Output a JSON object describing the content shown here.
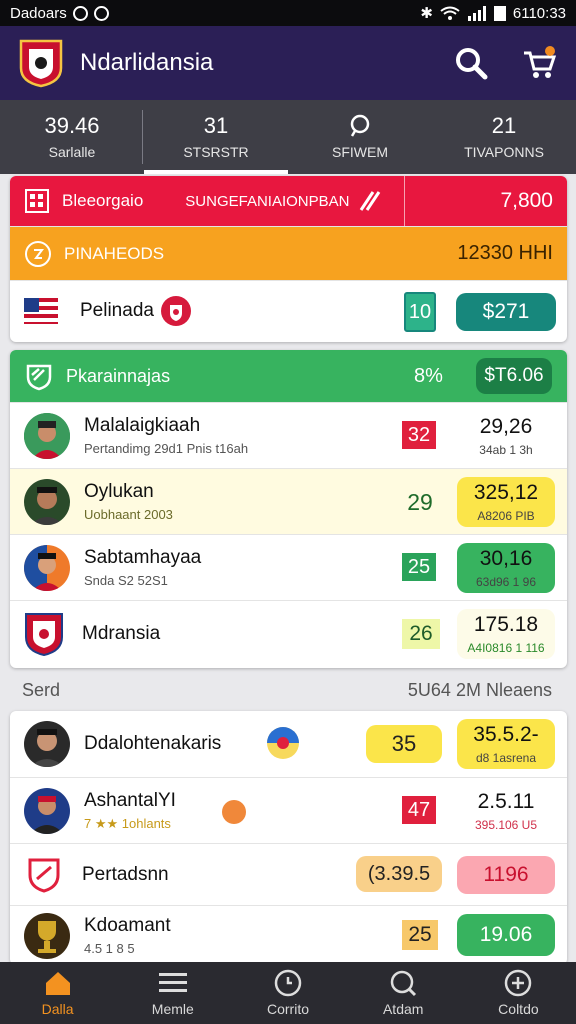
{
  "status_bar": {
    "carrier": "Dadoars",
    "time": "6110:33"
  },
  "app": {
    "title": "Ndarlidansia"
  },
  "tabs": [
    {
      "value": "39.46",
      "label": "Sarlalle"
    },
    {
      "value": "31",
      "label": "STSRSTR"
    },
    {
      "value": "",
      "label": "SFIWEM"
    },
    {
      "value": "21",
      "label": "TIVAPONNS"
    }
  ],
  "card1": {
    "header": {
      "left": "Bleeorgaio",
      "center": "SUNGEFANIAIONPBAN",
      "value": "7,800"
    },
    "sub_header": {
      "label": "PINAHEODS",
      "value": "12330 HHI"
    },
    "row": {
      "name": "Pelinada",
      "badge": "10",
      "value": "$271"
    }
  },
  "card2": {
    "header": {
      "label": "Pkarainnajas",
      "percent": "8%",
      "value": "$T6.06"
    },
    "rows": [
      {
        "name": "Malalaigkiaah",
        "sub": "Pertandimg 29d1 Pnis t16ah",
        "score": "32",
        "main": "29,26",
        "detail": "34ab 1 3h"
      },
      {
        "name": "Oylukan",
        "sub": "Uobhaant 2003",
        "score": "29",
        "main": "325,12",
        "detail": "A8206 PIB"
      },
      {
        "name": "Sabtamhayaa",
        "sub": "Snda S2 52S1",
        "score": "25",
        "main": "30,16",
        "detail": "63d96 1 96"
      },
      {
        "name": "Mdransia",
        "sub": "",
        "score": "26",
        "main": "175.18",
        "detail": "A4I0816 1 116"
      }
    ]
  },
  "section": {
    "title": "Serd",
    "meta": "5U64 2M Nleaens"
  },
  "card3": {
    "rows": [
      {
        "name": "Ddalohtenakaris",
        "sub": "",
        "score": "35",
        "main": "35.5.2-",
        "detail": "d8 1asrena"
      },
      {
        "name": "AshantalYI",
        "sub": "7 ★★ 1ohlants",
        "score": "47",
        "main": "2.5.11",
        "detail": "395.106 U5"
      },
      {
        "name": "Pertadsnn",
        "sub": "",
        "score": "(3.39.5",
        "main": "1196",
        "detail": ""
      },
      {
        "name": "Kdoamant",
        "sub": "4.5 1 8 5",
        "score": "25",
        "main": "19.06",
        "detail": ""
      }
    ]
  },
  "bottom_nav": [
    {
      "label": "Dalla",
      "icon": "home-icon"
    },
    {
      "label": "Memle",
      "icon": "menu-icon"
    },
    {
      "label": "Corrito",
      "icon": "clock-icon"
    },
    {
      "label": "Atdam",
      "icon": "search-icon"
    },
    {
      "label": "Coltdo",
      "icon": "add-icon"
    }
  ],
  "colors": {
    "appbar": "#2b1f56",
    "tabs": "#3e3e46",
    "red": "#e8173f",
    "orange": "#f7a21f",
    "green": "#37b35f",
    "teal": "#17877c",
    "yellow": "#fbe54a",
    "nav_active": "#f39220"
  }
}
